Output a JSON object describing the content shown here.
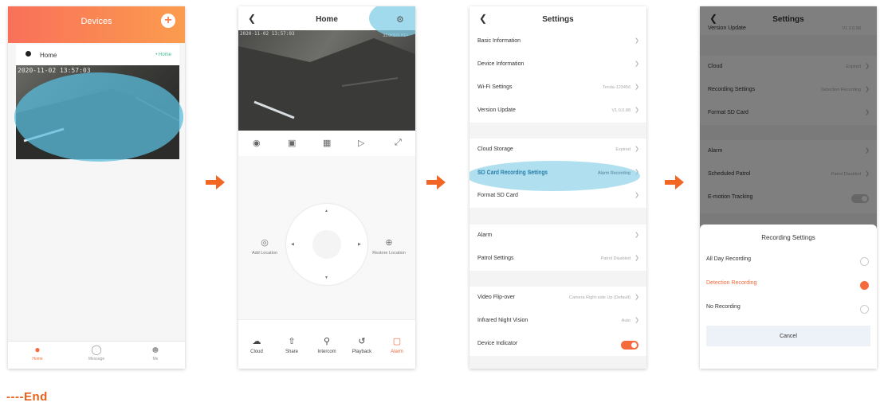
{
  "phone1": {
    "title": "Devices",
    "add_label": "+",
    "camera_name": "Home",
    "camera_tag": "• Home",
    "timestamp": "2020-11-02 13:57:03",
    "nav": [
      {
        "label": "Home",
        "icon": "home-icon"
      },
      {
        "label": "Message",
        "icon": "message-icon"
      },
      {
        "label": "Me",
        "icon": "person-icon"
      }
    ]
  },
  "phone2": {
    "title": "Home",
    "timestamp": "2020-11-02 13:57:03",
    "bitrate": "31.0KB/S  HD+",
    "left_label": "Add Location",
    "right_label": "Restore Location",
    "bottom": [
      {
        "label": "Cloud",
        "icon": "cloud-icon"
      },
      {
        "label": "Share",
        "icon": "share-icon"
      },
      {
        "label": "Intercom",
        "icon": "microphone-icon"
      },
      {
        "label": "Playback",
        "icon": "playback-icon"
      },
      {
        "label": "Alarm",
        "icon": "alarm-icon",
        "color": "#f46a3c"
      }
    ]
  },
  "settings": {
    "title": "Settings",
    "groups": [
      [
        {
          "label": "Basic Information",
          "value": ""
        },
        {
          "label": "Device Information",
          "value": ""
        },
        {
          "label": "Wi-Fi Settings",
          "value": "Tenda-123456"
        },
        {
          "label": "Version Update",
          "value": "V1.0.0.88"
        }
      ],
      [
        {
          "label": "Cloud Storage",
          "value": "Expired"
        },
        {
          "label": "SD Card Recording Settings",
          "value": "Alarm Recording"
        },
        {
          "label": "Format SD Card",
          "value": ""
        }
      ],
      [
        {
          "label": "Alarm",
          "value": ""
        },
        {
          "label": "Patrol Settings",
          "value": "Patrol Disabled"
        }
      ],
      [
        {
          "label": "Video Flip-over",
          "value": "Camera Right-side Up (Default)"
        },
        {
          "label": "Infrared Night Vision",
          "value": "Auto"
        },
        {
          "label": "Device Indicator",
          "value": ""
        }
      ]
    ]
  },
  "phone4": {
    "title": "Settings",
    "rows": [
      {
        "label": "Version Update",
        "value": "V1.0.0.88"
      },
      {
        "label": "Cloud",
        "value": "Expired"
      },
      {
        "label": "Recording Settings",
        "value": "Detection Recording"
      },
      {
        "label": "Format SD Card",
        "value": ""
      },
      {
        "label": "Alarm",
        "value": ""
      },
      {
        "label": "Scheduled Patrol",
        "value": "Patrol Disabled"
      },
      {
        "label": "E-motion Tracking",
        "value": ""
      }
    ],
    "sheet": {
      "title": "Recording Settings",
      "options": [
        {
          "label": "All Day Recording",
          "selected": false
        },
        {
          "label": "Detection Recording",
          "selected": true
        },
        {
          "label": "No Recording",
          "selected": false
        }
      ],
      "cancel": "Cancel"
    }
  },
  "footer": "----End",
  "colors": {
    "accent": "#f46a3c",
    "arrow": "#f26522",
    "highlight": "#5abedc"
  }
}
